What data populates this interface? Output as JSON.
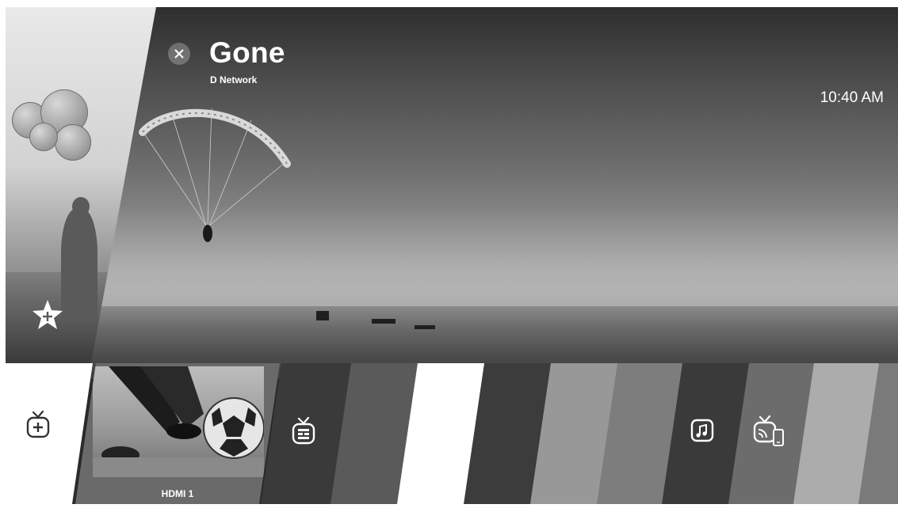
{
  "program": {
    "title": "Gone",
    "network": "D Network"
  },
  "clock": "10:40 AM",
  "launcher": {
    "inputs": [
      {
        "label": "HDMI 1"
      }
    ]
  },
  "icons": {
    "close": "close-icon",
    "favorite": "star-add-icon",
    "add_app": "add-tv-icon",
    "live_tv": "live-tv-icon",
    "music": "music-icon",
    "screen_share": "screen-share-icon"
  }
}
